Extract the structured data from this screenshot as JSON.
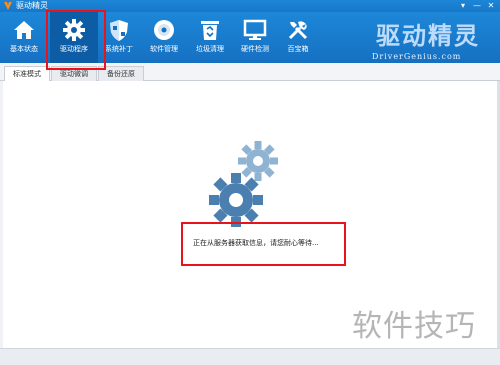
{
  "window": {
    "title": "驱动精灵",
    "controls": [
      "▾",
      "—",
      "✕"
    ]
  },
  "toolbar": {
    "items": [
      {
        "label": "基本状态",
        "icon": "home-icon",
        "active": false
      },
      {
        "label": "驱动程序",
        "icon": "gear-icon",
        "active": true
      },
      {
        "label": "系统补丁",
        "icon": "shield-icon",
        "active": false
      },
      {
        "label": "软件管理",
        "icon": "disc-icon",
        "active": false
      },
      {
        "label": "垃圾清理",
        "icon": "recycle-bin-icon",
        "active": false
      },
      {
        "label": "硬件检测",
        "icon": "monitor-icon",
        "active": false
      },
      {
        "label": "百宝箱",
        "icon": "tools-icon",
        "active": false
      }
    ]
  },
  "brand": {
    "name": "驱动精灵",
    "url": "DriverGenius.com"
  },
  "tabs": [
    {
      "label": "标准模式",
      "active": true
    },
    {
      "label": "驱动微调",
      "active": false
    },
    {
      "label": "备份还原",
      "active": false
    }
  ],
  "main": {
    "status_text": "正在从服务器获取信息，请您耐心等待..."
  },
  "watermark": "软件技巧",
  "colors": {
    "toolbar": "#1777c8",
    "active_tool": "#0d5ca6",
    "annotation": "#e8141b",
    "gear": "#4a7fb0"
  }
}
